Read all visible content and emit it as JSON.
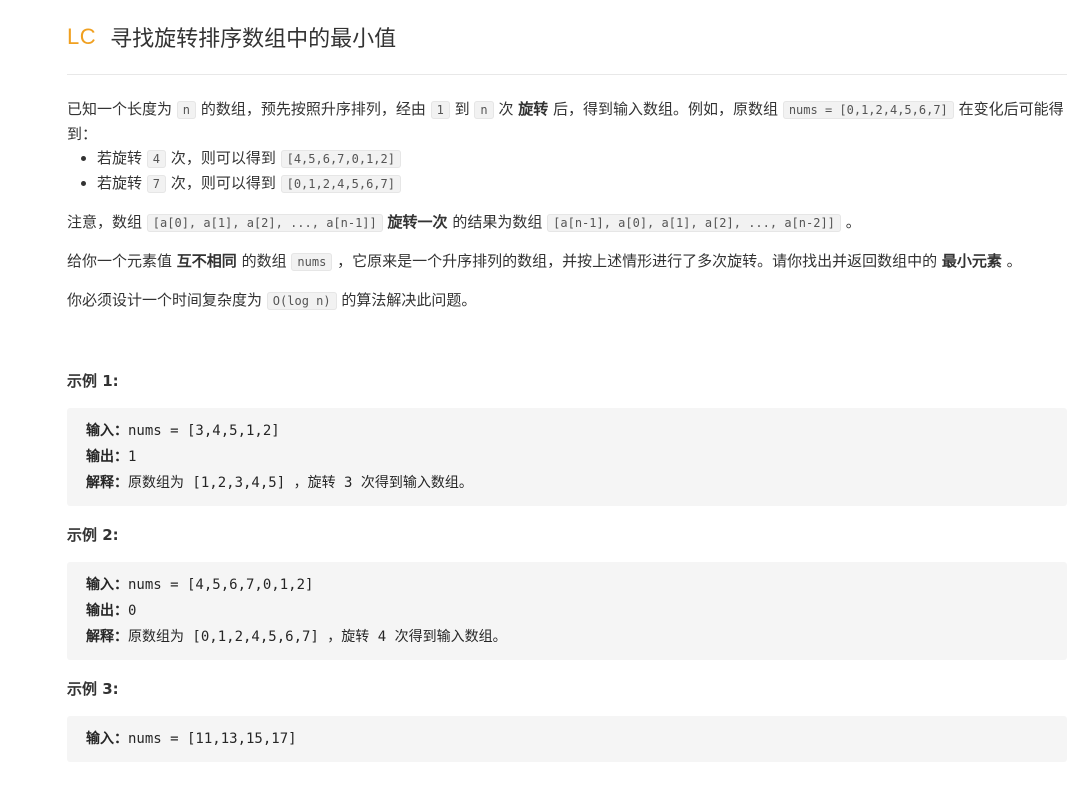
{
  "header": {
    "badge": "LC",
    "title": "寻找旋转排序数组中的最小值"
  },
  "intro": {
    "t1": "已知一个长度为",
    "n1": "n",
    "t2": "的数组，预先按照升序排列，经由",
    "c1": "1",
    "t3": "到",
    "n2": "n",
    "t4": "次",
    "b1": "旋转",
    "t5": "后，得到输入数组。例如，原数组",
    "c2": "nums = [0,1,2,4,5,6,7]",
    "t6": "在变化后可能得到："
  },
  "bullets": [
    {
      "a": "若旋转",
      "k": "4",
      "b": "次，则可以得到",
      "r": "[4,5,6,7,0,1,2]"
    },
    {
      "a": "若旋转",
      "k": "7",
      "b": "次，则可以得到",
      "r": "[0,1,2,4,5,6,7]"
    }
  ],
  "note": {
    "t1": "注意，数组",
    "c1": "[a[0], a[1], a[2], ..., a[n-1]]",
    "b1": "旋转一次",
    "t2": "的结果为数组",
    "c2": "[a[n-1], a[0], a[1], a[2], ..., a[n-2]]",
    "t3": "。"
  },
  "task": {
    "t1": "给你一个元素值",
    "b1": "互不相同",
    "t2": "的数组",
    "c1": "nums",
    "t3": "，它原来是一个升序排列的数组，并按上述情形进行了多次旋转。请你找出并返回数组中的",
    "b2": "最小元素",
    "t4": "。"
  },
  "complexity": {
    "t1": "你必须设计一个时间复杂度为",
    "c1": "O(log n)",
    "t2": "的算法解决此问题。"
  },
  "examples": [
    {
      "label": "示例 1:",
      "in_k": "输入：",
      "in_v": "nums = [3,4,5,1,2]",
      "out_k": "输出：",
      "out_v": "1",
      "ex_k": "解释：",
      "ex_a": "原数组为",
      "ex_b": " [1,2,3,4,5] ，",
      "ex_c": "旋转",
      "ex_d": " 3 ",
      "ex_e": "次得到输入数组。"
    },
    {
      "label": "示例 2:",
      "in_k": "输入：",
      "in_v": "nums = [4,5,6,7,0,1,2]",
      "out_k": "输出：",
      "out_v": "0",
      "ex_k": "解释：",
      "ex_a": "原数组为",
      "ex_b": " [0,1,2,4,5,6,7] ，",
      "ex_c": "旋转",
      "ex_d": " 4 ",
      "ex_e": "次得到输入数组。"
    },
    {
      "label": "示例 3:",
      "in_k": "输入：",
      "in_v": "nums = [11,13,15,17]"
    }
  ]
}
